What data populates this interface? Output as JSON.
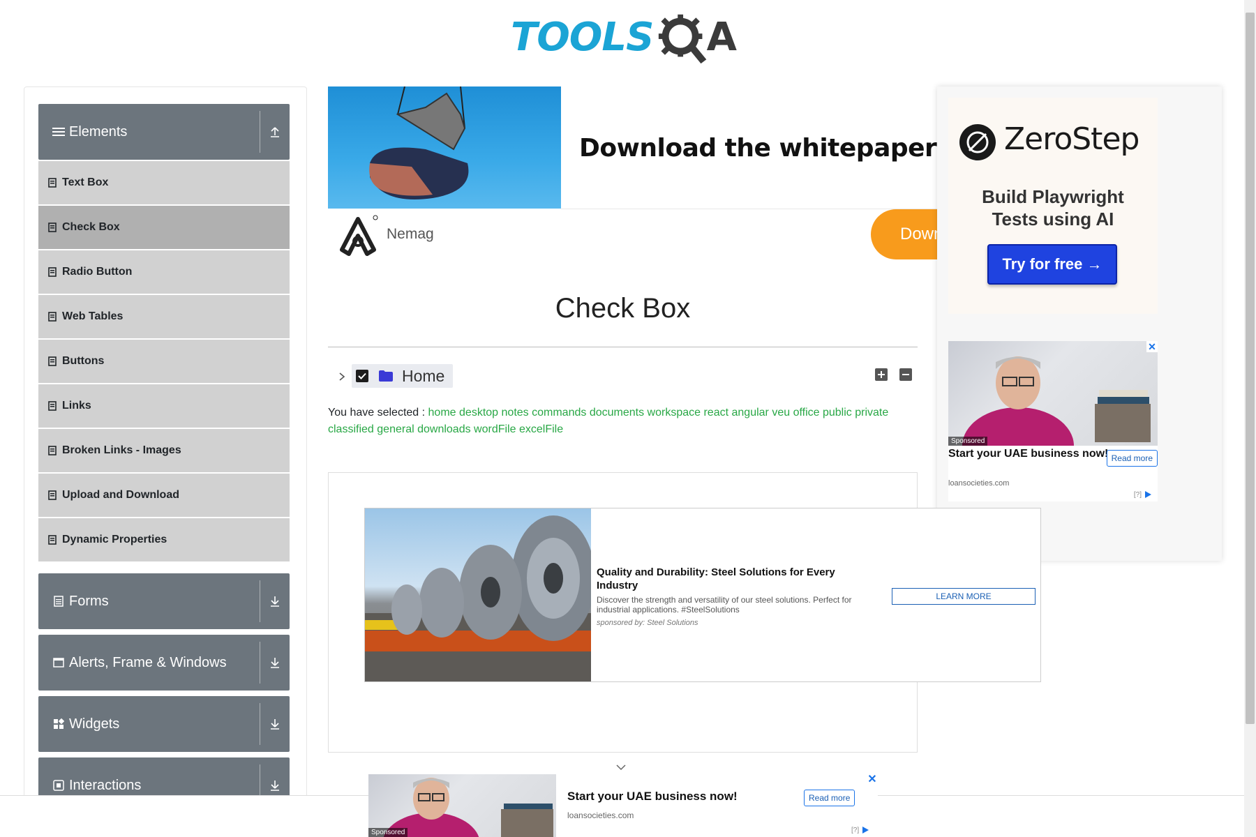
{
  "header": {
    "logo_text_tools": "TOOLS",
    "logo_text_a": "A",
    "brand_colors": {
      "tools": "#1ba4d5",
      "qa": "#3b3b3b"
    }
  },
  "sidebar": {
    "groups": [
      {
        "label": "Elements",
        "icon": "menu-icon",
        "arrow": "collapse-up-icon",
        "items": [
          "Text Box",
          "Check Box",
          "Radio Button",
          "Web Tables",
          "Buttons",
          "Links",
          "Broken Links - Images",
          "Upload and Download",
          "Dynamic Properties"
        ],
        "active_item": "Check Box"
      },
      {
        "label": "Forms",
        "icon": "form-icon",
        "arrow": "expand-down-icon"
      },
      {
        "label": "Alerts, Frame & Windows",
        "icon": "window-icon",
        "arrow": "expand-down-icon"
      },
      {
        "label": "Widgets",
        "icon": "widgets-icon",
        "arrow": "expand-down-icon"
      },
      {
        "label": "Interactions",
        "icon": "interactions-icon",
        "arrow": "expand-down-icon"
      }
    ]
  },
  "banner_ad": {
    "title": "Download the whitepaper",
    "brand": "Nemag",
    "button": "Down"
  },
  "right_ad": {
    "brand": "ZeroStep",
    "tagline_line1": "Build Playwright",
    "tagline_line2": "Tests using AI",
    "button": "Try for free →",
    "sub_ad": {
      "title": "Start your UAE business now!",
      "read_more": "Read more",
      "domain": "loansocieties.com",
      "sponsored": "Sponsored",
      "adinfo": "[?]"
    }
  },
  "main": {
    "title": "Check Box",
    "tree": {
      "root_label": "Home",
      "checked": true
    },
    "selected_prefix": "You have selected :",
    "selected_items": [
      "home",
      "desktop",
      "notes",
      "commands",
      "documents",
      "workspace",
      "react",
      "angular",
      "veu",
      "office",
      "public",
      "private",
      "classified",
      "general",
      "downloads",
      "wordFile",
      "excelFile"
    ]
  },
  "steel_ad": {
    "title": "Quality and Durability: Steel Solutions for Every Industry",
    "desc": "Discover the strength and versatility of our steel solutions. Perfect for industrial applications. #SteelSolutions",
    "sponsor": "sponsored by: Steel Solutions",
    "button": "LEARN MORE"
  },
  "bottom_ad": {
    "title": "Start your UAE business now!",
    "read_more": "Read more",
    "domain": "loansocieties.com",
    "sponsored": "Sponsored",
    "adinfo": "[?]",
    "close": "✕"
  },
  "colors": {
    "sidebar_header": "#6c757d",
    "menu_item": "#d1d1d1",
    "menu_active": "#b0b0b0",
    "selected_text": "#28a745",
    "zerostep_button": "#1f43e0",
    "banner_button": "#f89b1c"
  }
}
